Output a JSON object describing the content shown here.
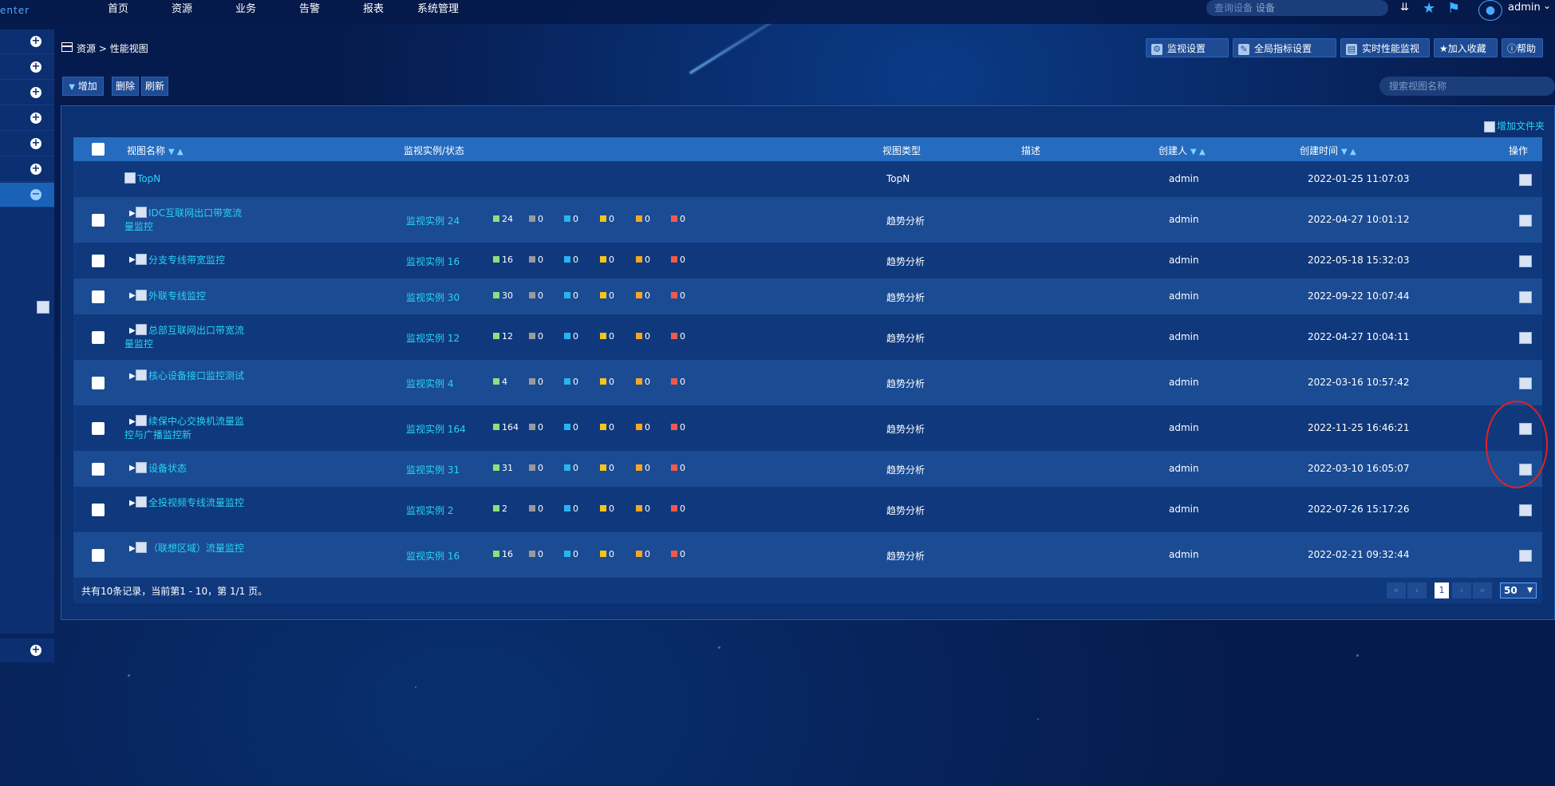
{
  "app": {
    "brand_fragment": "enter"
  },
  "nav": {
    "items": [
      "首页",
      "资源",
      "业务",
      "告警",
      "报表",
      "系统管理"
    ]
  },
  "topbar": {
    "search_text": "查询设备",
    "search_placeholder": "设备",
    "user": "admin",
    "icons": [
      "double-chevron-down-icon",
      "star-icon",
      "bookmark-icon",
      "user-avatar-icon"
    ]
  },
  "breadcrumb": {
    "root": "资源",
    "sep": ">",
    "current": "性能视图"
  },
  "toolbar": {
    "monitor_settings": "监视设置",
    "global_metric_settings": "全局指标设置",
    "realtime_monitor": "实时性能监视",
    "add_favorite": "加入收藏",
    "help": "帮助"
  },
  "actions": {
    "add": "增加",
    "delete": "删除",
    "refresh": "刷新"
  },
  "view_search": {
    "placeholder": "搜索视图名称"
  },
  "add_folder": "增加文件夹",
  "table": {
    "headers": {
      "name": "视图名称",
      "instance": "监视实例/状态",
      "type": "视图类型",
      "desc": "描述",
      "creator": "创建人",
      "created": "创建时间",
      "op": "操作"
    },
    "status_colors": [
      "#8de07a",
      "#9a9a9a",
      "#27b4f0",
      "#f5c518",
      "#f5a623",
      "#f2594b"
    ],
    "rows": [
      {
        "name": "TopN",
        "instance": "",
        "counts": null,
        "type": "TopN",
        "creator": "admin",
        "created": "2022-01-25 11:07:03"
      },
      {
        "name": "IDC互联网出口带宽流量监控",
        "instance": "监视实例 24",
        "counts": [
          "24",
          "0",
          "0",
          "0",
          "0",
          "0"
        ],
        "type": "趋势分析",
        "creator": "admin",
        "created": "2022-04-27 10:01:12"
      },
      {
        "name": "分支专线带宽监控",
        "instance": "监视实例 16",
        "counts": [
          "16",
          "0",
          "0",
          "0",
          "0",
          "0"
        ],
        "type": "趋势分析",
        "creator": "admin",
        "created": "2022-05-18 15:32:03"
      },
      {
        "name": "外联专线监控",
        "instance": "监视实例 30",
        "counts": [
          "30",
          "0",
          "0",
          "0",
          "0",
          "0"
        ],
        "type": "趋势分析",
        "creator": "admin",
        "created": "2022-09-22 10:07:44"
      },
      {
        "name": "总部互联网出口带宽流量监控",
        "instance": "监视实例 12",
        "counts": [
          "12",
          "0",
          "0",
          "0",
          "0",
          "0"
        ],
        "type": "趋势分析",
        "creator": "admin",
        "created": "2022-04-27 10:04:11"
      },
      {
        "name": "核心设备接口监控测试",
        "instance": "监视实例 4",
        "counts": [
          "4",
          "0",
          "0",
          "0",
          "0",
          "0"
        ],
        "type": "趋势分析",
        "creator": "admin",
        "created": "2022-03-16 10:57:42"
      },
      {
        "name": "续保中心交换机流量监控与广播监控新",
        "instance": "监视实例 164",
        "counts": [
          "164",
          "0",
          "0",
          "0",
          "0",
          "0"
        ],
        "type": "趋势分析",
        "creator": "admin",
        "created": "2022-11-25 16:46:21"
      },
      {
        "name": "设备状态",
        "instance": "监视实例 31",
        "counts": [
          "31",
          "0",
          "0",
          "0",
          "0",
          "0"
        ],
        "type": "趋势分析",
        "creator": "admin",
        "created": "2022-03-10 16:05:07"
      },
      {
        "name": "全投视频专线流量监控",
        "instance": "监视实例 2",
        "counts": [
          "2",
          "0",
          "0",
          "0",
          "0",
          "0"
        ],
        "type": "趋势分析",
        "creator": "admin",
        "created": "2022-07-26 15:17:26"
      },
      {
        "name": "（联想区域）流量监控",
        "instance": "监视实例 16",
        "counts": [
          "16",
          "0",
          "0",
          "0",
          "0",
          "0"
        ],
        "type": "趋势分析",
        "creator": "admin",
        "created": "2022-02-21 09:32:44"
      }
    ]
  },
  "pagination": {
    "summary": "共有10条记录，当前第1 - 10，第 1/1 页。",
    "current_page": "1",
    "page_size": "50",
    "first": "«",
    "prev": "‹",
    "next": "›",
    "last": "»"
  }
}
